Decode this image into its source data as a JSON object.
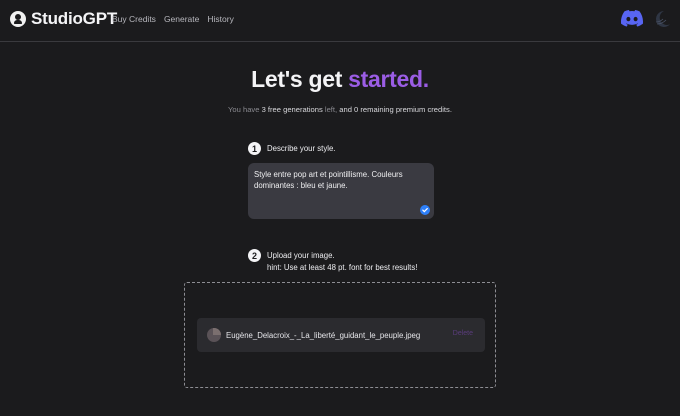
{
  "header": {
    "brand": "StudioGPT",
    "nav": [
      "Buy Credits",
      "Generate",
      "History"
    ]
  },
  "hero": {
    "title_start": "Let's get ",
    "title_accent": "started.",
    "sub_prefix": "You have ",
    "sub_free": "3 free generations",
    "sub_mid": " left, ",
    "sub_premium": "and 0 remaining premium credits."
  },
  "steps": [
    {
      "num": "1",
      "label": "Describe your style."
    },
    {
      "num": "2",
      "label": "Upload your image.",
      "hint": "hint: Use at least 48 pt. font for best results!"
    }
  ],
  "style_input": {
    "value": "Style entre pop art et pointillisme. Couleurs dominantes : bleu et jaune."
  },
  "upload": {
    "file_name": "Eugène_Delacroix_-_La_liberté_guidant_le_peuple.jpeg",
    "action": "Delete"
  },
  "colors": {
    "accent": "#9b5de5",
    "background": "#1b1b1d",
    "discord": "#5865f2"
  },
  "icons": [
    "discord-icon",
    "theme-toggle-icon",
    "check-icon"
  ]
}
